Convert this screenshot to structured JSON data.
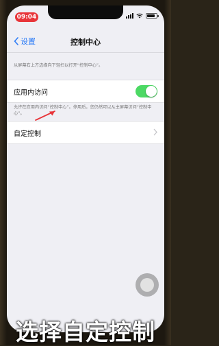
{
  "status_bar": {
    "time": "09:04"
  },
  "nav": {
    "back_label": "设置",
    "title": "控制中心"
  },
  "intro_text": "从屏幕右上方边缘向下轻扫以打开“控制中心”。",
  "access_within_apps": {
    "label": "应用内访问",
    "enabled": true,
    "description": "允许在应用内访问“控制中心”。停用后，您仍然可以从主屏幕访问“控制中心”。"
  },
  "customize_controls": {
    "label": "自定控制"
  },
  "annotation": {
    "color": "#e8353a"
  },
  "caption": "选择自定控制",
  "colors": {
    "accent": "#2d7cf6",
    "toggle_on": "#4cd964",
    "time_pill": "#e8353a"
  }
}
